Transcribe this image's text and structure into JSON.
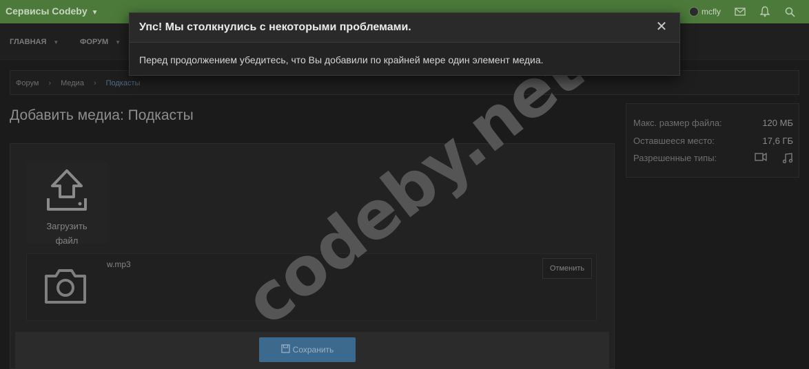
{
  "header": {
    "brand": "Сервисы Codeby",
    "username": "mcfly",
    "icons": [
      "envelope-icon",
      "bell-icon",
      "search-icon"
    ],
    "color": "#4b7a3a"
  },
  "nav": {
    "items": [
      {
        "label": "ГЛАВНАЯ"
      },
      {
        "label": "ФОРУМ"
      }
    ]
  },
  "breadcrumb": {
    "items": [
      "Форум",
      "Медиа",
      "Подкасты"
    ]
  },
  "page": {
    "title": "Добавить медиа: Подкасты"
  },
  "upload": {
    "label_line1": "Загрузить",
    "label_line2": "файл"
  },
  "file": {
    "name": "w.mp3",
    "cancel_label": "Отменить"
  },
  "footer": {
    "save_label": "Сохранить",
    "save_color": "#3c6a8e"
  },
  "sidebar": {
    "max_size_label": "Макс. размер файла:",
    "max_size_value": "120 МБ",
    "space_label": "Оставшееся место:",
    "space_value": "17,6 ГБ",
    "types_label": "Разрешенные типы:",
    "type_icons": [
      "video-icon",
      "music-icon"
    ]
  },
  "watermark": "codeby.net",
  "modal": {
    "title": "Упс! Мы столкнулись с некоторыми проблемами.",
    "message": "Перед продолжением убедитесь, что Вы добавили по крайней мере один элемент медиа.",
    "close_symbol": "✕"
  }
}
